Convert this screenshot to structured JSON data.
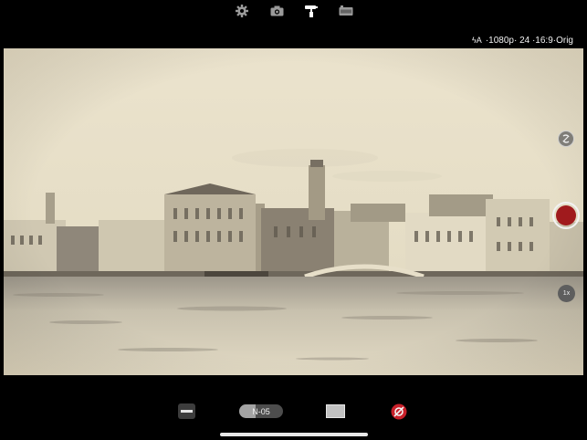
{
  "toolbar": {
    "icons": [
      "gear-icon",
      "camera-icon",
      "paint-roller-icon",
      "film-icon"
    ]
  },
  "status": {
    "flash_glyph": "ϟA",
    "format_text": "·1080p· 24 ·16:9·Orig"
  },
  "controls": {
    "zoom_label": "1x",
    "lens_label": "N-05"
  },
  "colors": {
    "record": "#a01a1d",
    "sepia_sky": "#ece5d0",
    "toolbar_active": "#ffffff",
    "toolbar_inactive": "#9a9a9a"
  }
}
